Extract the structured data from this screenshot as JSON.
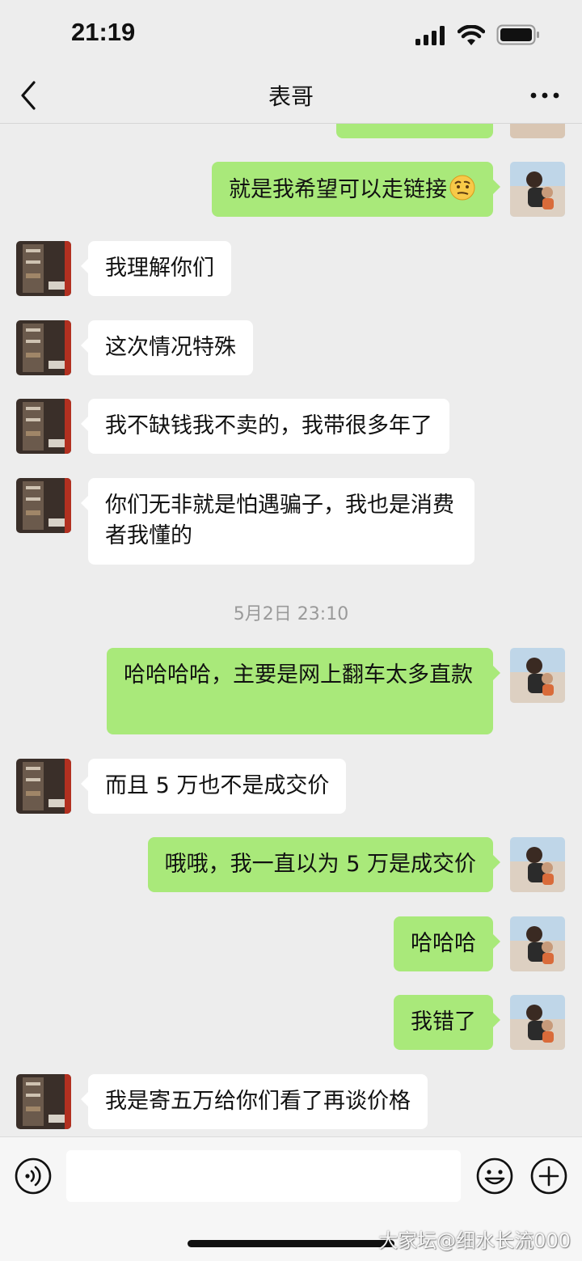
{
  "status_bar": {
    "time": "21:19"
  },
  "header": {
    "title": "表哥",
    "back_icon": "chevron-left-icon",
    "more_icon": "ellipsis-icon"
  },
  "messages": [
    {
      "side": "out",
      "text": ""
    },
    {
      "side": "out",
      "text": "就是我希望可以走链接"
    },
    {
      "side": "in",
      "text": "我理解你们"
    },
    {
      "side": "in",
      "text": "这次情况特殊"
    },
    {
      "side": "in",
      "text": "我不缺钱我不卖的，我带很多年了"
    },
    {
      "side": "in",
      "text": "你们无非就是怕遇骗子，我也是消费者我懂的"
    },
    {
      "side": "time",
      "text": "5月2日 23:10"
    },
    {
      "side": "out",
      "text": "哈哈哈哈，主要是网上翻车太多直款"
    },
    {
      "side": "in",
      "text": "而且 5 万也不是成交价"
    },
    {
      "side": "out",
      "text": "哦哦，我一直以为 5 万是成交价"
    },
    {
      "side": "out",
      "text": "哈哈哈"
    },
    {
      "side": "out",
      "text": "我错了"
    },
    {
      "side": "in",
      "text": "我是寄五万给你们看了再谈价格"
    }
  ],
  "input_bar": {
    "voice_icon": "voice-icon",
    "emoji_icon": "emoji-icon",
    "plus_icon": "plus-icon"
  },
  "watermark": "大家坛@细水长流000",
  "colors": {
    "background": "#ededed",
    "outgoing_bubble": "#a9e97a",
    "incoming_bubble": "#ffffff"
  }
}
